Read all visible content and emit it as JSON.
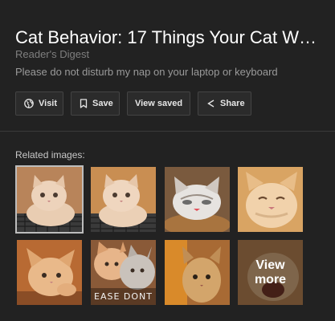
{
  "result": {
    "title": "Cat Behavior: 17 Things Your Cat W…",
    "source": "Reader's Digest",
    "description": "Please do not disturb my nap on your laptop or keyboard"
  },
  "actions": {
    "visit_label": "Visit",
    "save_label": "Save",
    "view_saved_label": "View saved",
    "share_label": "Share"
  },
  "related": {
    "label": "Related images:",
    "view_more_line1": "View",
    "view_more_line2": "more",
    "thumb_caption_7": "EASE DONT"
  },
  "colors": {
    "background": "#222222",
    "button_border": "#444444",
    "muted_text": "#7f7f7f"
  }
}
